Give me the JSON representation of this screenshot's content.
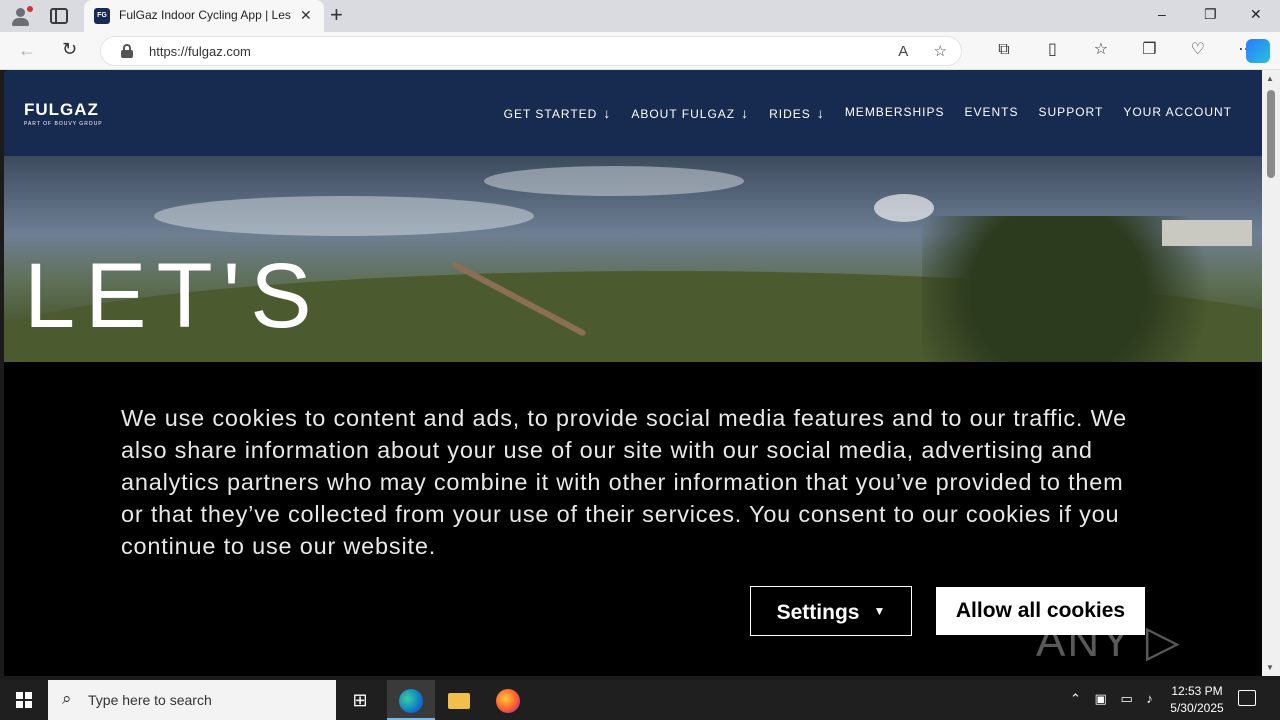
{
  "browser": {
    "tab_title": "FulGaz Indoor Cycling App | Less",
    "url": "https://fulgaz.com",
    "new_tab_symbol": "+",
    "window_controls": [
      "–",
      "❐",
      "✕"
    ],
    "favicon_text": "FG"
  },
  "site": {
    "logo": "FULGAZ",
    "logo_sub": "PART OF BOUVY GROUP",
    "nav": [
      {
        "label": "GET STARTED",
        "dropdown": true
      },
      {
        "label": "ABOUT FULGAZ",
        "dropdown": true
      },
      {
        "label": "RIDES",
        "dropdown": true
      },
      {
        "label": "MEMBERSHIPS",
        "dropdown": false
      },
      {
        "label": "EVENTS",
        "dropdown": false
      },
      {
        "label": "SUPPORT",
        "dropdown": false
      },
      {
        "label": "YOUR ACCOUNT",
        "dropdown": false
      }
    ],
    "hero_title": "LET'S"
  },
  "cookie_banner": {
    "text": "We use cookies to content and ads, to provide social media features and to our traffic. We also share information about your use of our site with our social media, advertising and analytics partners who may combine it with other information that you’ve provided to them or that they’ve collected from your use of their services. You consent to our cookies if you continue to use our website.",
    "settings_label": "Settings",
    "allow_label": "Allow all cookies"
  },
  "watermark": "ANY ▷ RUN",
  "taskbar": {
    "search_placeholder": "Type here to search",
    "time": "12:53 PM",
    "date": "5/30/2025"
  },
  "colors": {
    "header_bg": "#172a50",
    "banner_bg": "#000000",
    "accent_copilot": "#2a7bff"
  }
}
